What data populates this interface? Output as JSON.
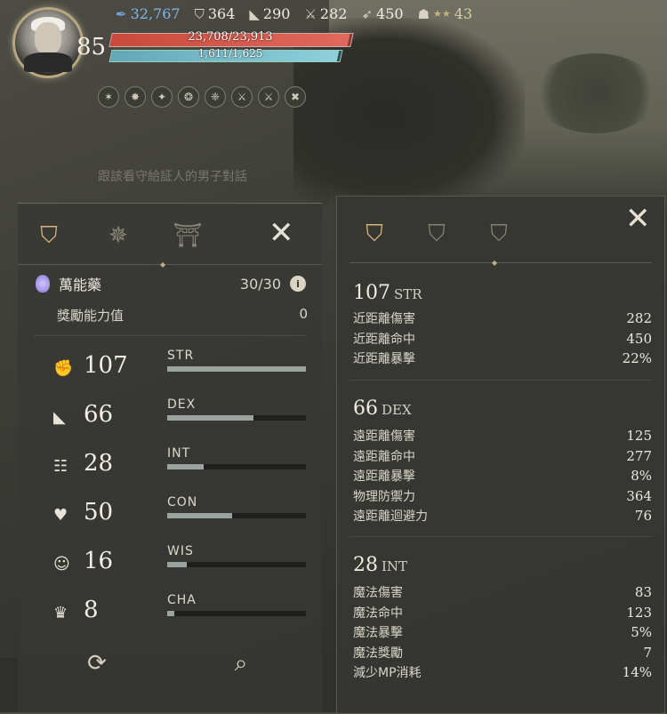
{
  "hud": {
    "level": "85",
    "hp_text": "23,708/23,913",
    "mp_text": "1,611/1,625",
    "stats": [
      {
        "icon": "feather-icon",
        "value": "32,767"
      },
      {
        "icon": "helmet-icon",
        "value": "364"
      },
      {
        "icon": "boot-icon",
        "value": "290"
      },
      {
        "icon": "sword-icon",
        "value": "282"
      },
      {
        "icon": "bow-icon",
        "value": "450"
      },
      {
        "icon": "trophy-icon",
        "value": "43",
        "stars": "★★"
      }
    ],
    "quest_text": "跟該看守給証人的男子對話"
  },
  "left": {
    "potion": {
      "name": "萬能藥",
      "value": "30/30",
      "info": "i"
    },
    "bonus": {
      "label": "獎勵能力值",
      "value": "0"
    },
    "attributes": [
      {
        "value": "107",
        "name": "STR",
        "fill": 1.0
      },
      {
        "value": "66",
        "name": "DEX",
        "fill": 0.62
      },
      {
        "value": "28",
        "name": "INT",
        "fill": 0.26
      },
      {
        "value": "50",
        "name": "CON",
        "fill": 0.47
      },
      {
        "value": "16",
        "name": "WIS",
        "fill": 0.14
      },
      {
        "value": "8",
        "name": "CHA",
        "fill": 0.05
      }
    ]
  },
  "right": {
    "str": {
      "num": "107",
      "label": "STR",
      "items": [
        {
          "label": "近距離傷害",
          "value": "282"
        },
        {
          "label": "近距離命中",
          "value": "450"
        },
        {
          "label": "近距離暴擊",
          "value": "22%"
        }
      ]
    },
    "dex": {
      "num": "66",
      "label": "DEX",
      "items": [
        {
          "label": "遠距離傷害",
          "value": "125"
        },
        {
          "label": "遠距離命中",
          "value": "277"
        },
        {
          "label": "遠距離暴擊",
          "value": "8%"
        },
        {
          "label": "物理防禦力",
          "value": "364"
        },
        {
          "label": "遠距離迴避力",
          "value": "76"
        }
      ]
    },
    "int": {
      "num": "28",
      "label": "INT",
      "items": [
        {
          "label": "魔法傷害",
          "value": "83"
        },
        {
          "label": "魔法命中",
          "value": "123"
        },
        {
          "label": "魔法暴擊",
          "value": "5%"
        },
        {
          "label": "魔法獎勵",
          "value": "7"
        },
        {
          "label": "減少MP消耗",
          "value": "14%"
        }
      ]
    }
  },
  "colors": {
    "hp": "#d45a4b",
    "mp": "#7cc1cf",
    "accent": "#d8b47a"
  }
}
